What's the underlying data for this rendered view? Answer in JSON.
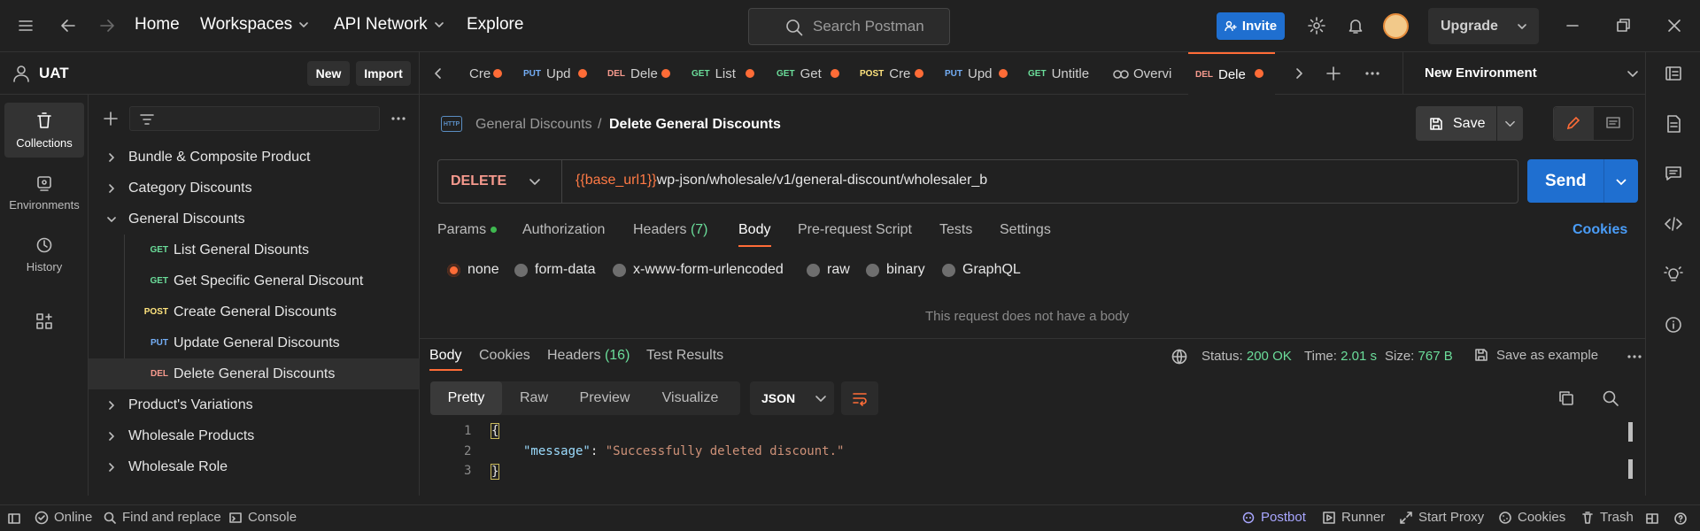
{
  "topbar": {
    "nav": {
      "home": "Home",
      "workspaces": "Workspaces",
      "api_network": "API Network",
      "explore": "Explore"
    },
    "search_placeholder": "Search Postman",
    "invite_label": "Invite",
    "upgrade_label": "Upgrade"
  },
  "workspace": {
    "name": "UAT",
    "new_label": "New",
    "import_label": "Import"
  },
  "rail": {
    "items": [
      {
        "label": "Collections",
        "icon": "collections-icon",
        "active": true
      },
      {
        "label": "Environments",
        "icon": "environments-icon"
      },
      {
        "label": "History",
        "icon": "history-icon"
      }
    ]
  },
  "sidebar": {
    "tree": [
      {
        "label": "Bundle & Composite Product",
        "type": "folder"
      },
      {
        "label": "Category Discounts",
        "type": "folder"
      },
      {
        "label": "General Discounts",
        "type": "folder-open"
      },
      {
        "method": "GET",
        "label": "List General Disounts"
      },
      {
        "method": "GET",
        "label": "Get Specific General Discount"
      },
      {
        "method": "POST",
        "label": "Create General Discounts"
      },
      {
        "method": "PUT",
        "label": "Update General Discounts"
      },
      {
        "method": "DEL",
        "label": "Delete General Discounts",
        "selected": true
      },
      {
        "label": "Product's Variations",
        "type": "folder"
      },
      {
        "label": "Wholesale Products",
        "type": "folder"
      },
      {
        "label": "Wholesale Role",
        "type": "folder"
      }
    ]
  },
  "tabs": [
    {
      "method": "",
      "label": "Cre"
    },
    {
      "method": "PUT",
      "label": "Upd"
    },
    {
      "method": "DEL",
      "label": "Dele"
    },
    {
      "method": "GET",
      "label": "List"
    },
    {
      "method": "GET",
      "label": "Get"
    },
    {
      "method": "POST",
      "label": "Cre"
    },
    {
      "method": "PUT",
      "label": "Upd"
    },
    {
      "method": "GET",
      "label": "Untitle"
    },
    {
      "method": "",
      "label": "Overvi"
    },
    {
      "method": "DEL",
      "label": "Dele",
      "active": true
    }
  ],
  "environment": {
    "selected": "New Environment"
  },
  "request": {
    "breadcrumb_parent": "General Discounts",
    "breadcrumb_separator": "/",
    "title": "Delete General Discounts",
    "save_label": "Save",
    "method": "DELETE",
    "url_var": "{{base_url1}}",
    "url_path": "wp-json/wholesale/v1/general-discount/wholesaler_b",
    "send_label": "Send",
    "tabs": {
      "params": "Params",
      "authorization": "Authorization",
      "headers": "Headers",
      "headers_count": "(7)",
      "body": "Body",
      "prerequest": "Pre-request Script",
      "tests": "Tests",
      "settings": "Settings"
    },
    "cookies_link": "Cookies",
    "body_types": [
      "none",
      "form-data",
      "x-www-form-urlencoded",
      "raw",
      "binary",
      "GraphQL"
    ],
    "body_selected": "none",
    "no_body_text": "This request does not have a body"
  },
  "response": {
    "tabs": {
      "body": "Body",
      "cookies": "Cookies",
      "headers": "Headers",
      "headers_count": "(16)",
      "test_results": "Test Results"
    },
    "status_label": "Status:",
    "status_value": "200 OK",
    "time_label": "Time:",
    "time_value": "2.01 s",
    "size_label": "Size:",
    "size_value": "767 B",
    "save_example": "Save as example",
    "view_tabs": [
      "Pretty",
      "Raw",
      "Preview",
      "Visualize"
    ],
    "format": "JSON",
    "code": {
      "line_numbers": [
        "1",
        "2",
        "3"
      ],
      "open_brace": "{",
      "key": "\"message\"",
      "colon": ":",
      "value": "\"Successfully deleted discount.\"",
      "close_brace": "}"
    }
  },
  "statusbar": {
    "online": "Online",
    "find_replace": "Find and replace",
    "console": "Console",
    "postbot": "Postbot",
    "runner": "Runner",
    "start_proxy": "Start Proxy",
    "cookies": "Cookies",
    "trash": "Trash"
  },
  "colors": {
    "accent": "#ff6c37",
    "primary": "#1f6fd0",
    "get": "#6bdd9a",
    "post": "#ffe47e",
    "put": "#74aef6",
    "del": "#f79a8e",
    "status_ok": "#6bdd9a"
  }
}
